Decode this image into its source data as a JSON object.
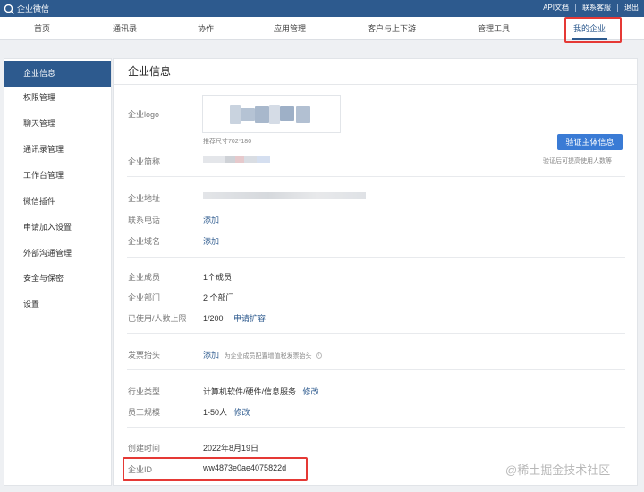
{
  "topbar": {
    "app_name": "企业微信",
    "links": [
      "API文档",
      "联系客服",
      "退出"
    ]
  },
  "nav": {
    "items": [
      "首页",
      "通讯录",
      "协作",
      "应用管理",
      "客户与上下游",
      "管理工具",
      "我的企业"
    ],
    "active": "我的企业"
  },
  "sidebar": {
    "items": [
      "企业信息",
      "权限管理",
      "聊天管理",
      "通讯录管理",
      "工作台管理",
      "微信插件",
      "申请加入设置",
      "外部沟通管理",
      "安全与保密",
      "设置"
    ],
    "active": "企业信息"
  },
  "main": {
    "title": "企业信息",
    "logo": {
      "label": "企业logo",
      "size_hint": "推荐尺寸702*180"
    },
    "short_name": {
      "label": "企业简称"
    },
    "verify": {
      "button": "验证主体信息",
      "hint": "验证后可提高使用人数等"
    },
    "address": {
      "label": "企业地址"
    },
    "phone": {
      "label": "联系电话",
      "action": "添加"
    },
    "domain": {
      "label": "企业域名",
      "action": "添加"
    },
    "members": {
      "label": "企业成员",
      "value": "1个成员"
    },
    "departments": {
      "label": "企业部门",
      "value": "2 个部门"
    },
    "limit": {
      "label": "已使用/人数上限",
      "value": "1/200",
      "action": "申请扩容"
    },
    "invoice": {
      "label": "发票抬头",
      "action": "添加",
      "hint": "为企业成员配置增值税发票抬头"
    },
    "industry": {
      "label": "行业类型",
      "value": "计算机软件/硬件/信息服务",
      "action": "修改"
    },
    "scale": {
      "label": "员工规模",
      "value": "1-50人",
      "action": "修改"
    },
    "created": {
      "label": "创建时间",
      "value": "2022年8月19日"
    },
    "corp_id": {
      "label": "企业ID",
      "value": "ww4873e0ae4075822d"
    }
  },
  "watermark": "@稀土掘金技术社区",
  "colors": {
    "brand": "#2d5a8e",
    "button": "#3a7bd5",
    "highlight": "#e53935"
  }
}
